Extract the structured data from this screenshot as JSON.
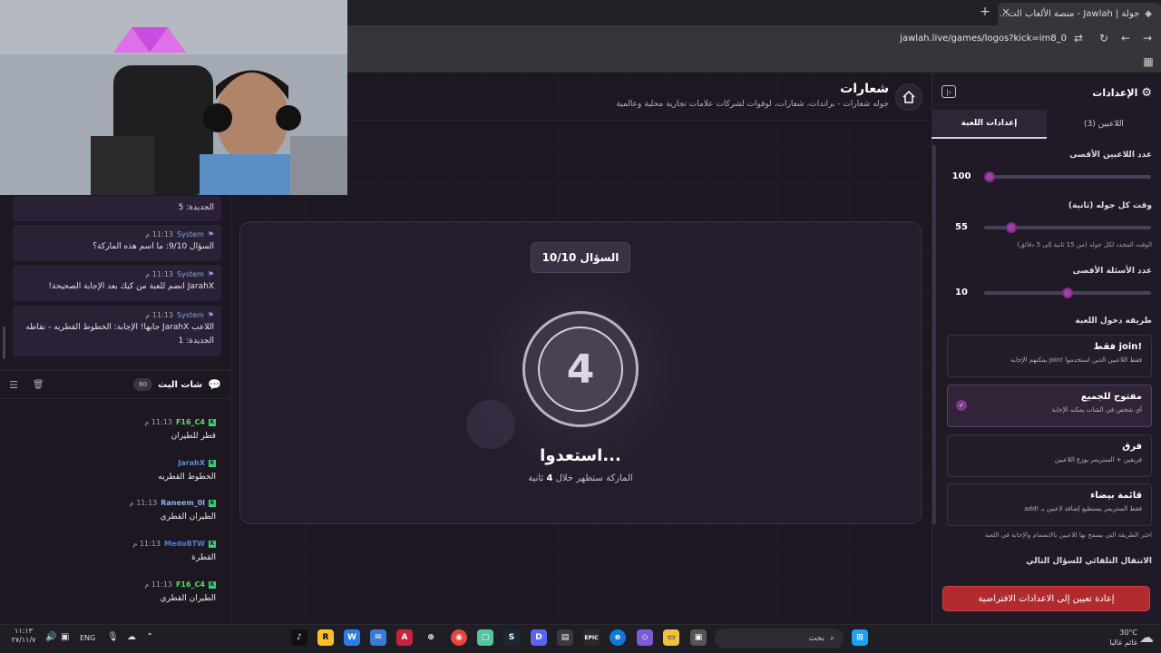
{
  "browser": {
    "tab_title": "جولة | Jawlah - منصة الألعاب الت...",
    "url": "jawlah.live/games/logos?kick=im8_0"
  },
  "header": {
    "title": "شعارات",
    "subtitle": "جوله شعارات - براندات، شعارات، لوقوات لشركات علامات تجارية محلية وعالمية"
  },
  "game": {
    "question_label": "السؤال 10/10",
    "countdown": "4",
    "ready_text": "استعدوا...",
    "appear_prefix": "الماركة ستظهر خلال",
    "appear_seconds": "4",
    "appear_suffix": "ثانية"
  },
  "system_messages": [
    {
      "sender": "System",
      "time": "11:13 م",
      "text": "الجديدة: 5"
    },
    {
      "sender": "System",
      "time": "11:13 م",
      "text": "السؤال 9/10: ما اسم هذه الماركة؟"
    },
    {
      "sender": "System",
      "time": "11:13 م",
      "text": "JarahX انضم للعبة من كيك بعد الإجابة الصحيحة!"
    },
    {
      "sender": "System",
      "time": "11:13 م",
      "text": "اللاعب JarahX جابها! الإجابة: الخطوط القطريه - نقاطه الجديدة: 1"
    }
  ],
  "chat": {
    "title": "شات البث",
    "count": "60",
    "messages": [
      {
        "user": "F16_C4",
        "time": "11:13 م",
        "text": "قطر للطيران",
        "color": "#57e35a"
      },
      {
        "user": "JarahX",
        "time": "",
        "text": "الخطوط القطريه",
        "color": "#5b8fe0"
      },
      {
        "user": "Raneem_0l",
        "time": "11:13 م",
        "text": "الطيران القطري",
        "color": "#8fb4f0"
      },
      {
        "user": "MedoBTW",
        "time": "11:13 م",
        "text": "القطرة",
        "color": "#4a7fe0"
      },
      {
        "user": "F16_C4",
        "time": "11:13 م",
        "text": "الطيران القطري",
        "color": "#57e35a"
      }
    ]
  },
  "settings": {
    "title": "الإعدادات",
    "tabs": {
      "players": "اللاعبين (3)",
      "game": "إعدادات اللعبة"
    },
    "max_players": {
      "label": "عدد اللاعبين الأقصى",
      "value": "100",
      "fraction": 0.0
    },
    "round_time": {
      "label": "وقت كل جوله (ثانية)",
      "value": "55",
      "fraction": 0.14,
      "hint": "الوقت المحدد لكل جوله (من 15 ثانية إلى 5 دقائق)"
    },
    "max_questions": {
      "label": "عدد الأسئلة الأقصى",
      "value": "10",
      "fraction": 0.5
    },
    "entry_label": "طريقة دخول اللعبة",
    "options": [
      {
        "title": "!join فقط",
        "desc": "فقط اللاعبين الذين استخدموا !join يمكنهم الإجابة"
      },
      {
        "title": "مفتوح للجميع",
        "desc": "أي شخص في الشات يمكنه الإجابة"
      },
      {
        "title": "فرق",
        "desc": "فريقين + الستريمر يوزع اللاعبين"
      },
      {
        "title": "قائمة بيضاء",
        "desc": "فقط الستريمر يستطيع إضافة لاعبين بـ !add"
      }
    ],
    "entry_hint": "اختر الطريقة التي يسمح بها للاعبين بالانضمام والإجابة في اللعبة",
    "auto_next": "الانتقال التلقائي للسؤال التالي",
    "reset_button": "إعادة تعيين إلى الاعدادات الافتراضية"
  },
  "taskbar": {
    "search_placeholder": "بحث",
    "language": "ENG",
    "clock_time": "١١:١٣",
    "clock_date": "٢٧/١١/٧",
    "weather_temp": "30°C",
    "weather_desc": "غائم غالبا"
  }
}
